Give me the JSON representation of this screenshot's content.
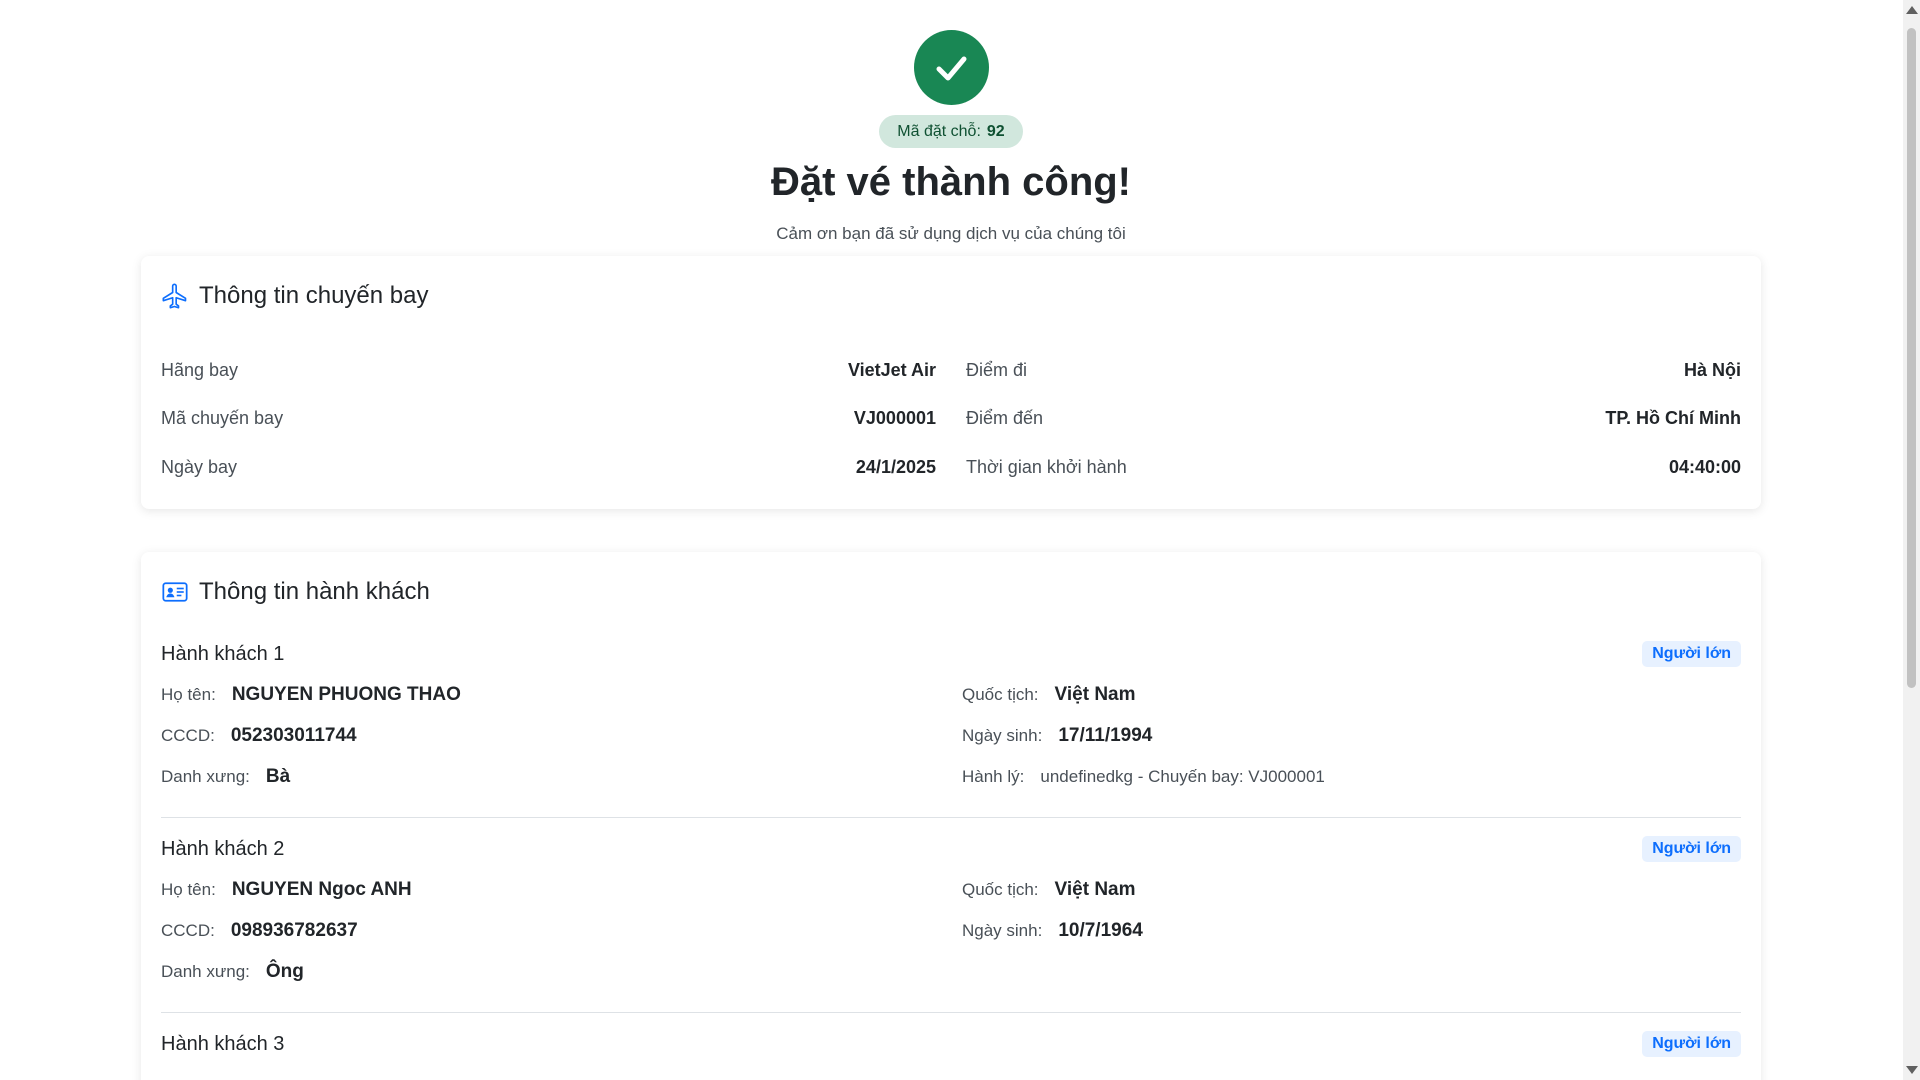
{
  "hero": {
    "booking_label": "Mã đặt chỗ:",
    "booking_code": "92",
    "title": "Đặt vé thành công!",
    "subtitle": "Cảm ơn bạn đã sử dụng dịch vụ của chúng tôi",
    "success_color": "#198754"
  },
  "flight": {
    "header": "Thông tin chuyến bay",
    "icon": "airplane-icon",
    "left": [
      {
        "label": "Hãng bay",
        "value": "VietJet Air"
      },
      {
        "label": "Mã chuyến bay",
        "value": "VJ000001"
      },
      {
        "label": "Ngày bay",
        "value": "24/1/2025"
      }
    ],
    "right": [
      {
        "label": "Điểm đi",
        "value": "Hà Nội"
      },
      {
        "label": "Điểm đến",
        "value": "TP. Hồ Chí Minh"
      },
      {
        "label": "Thời gian khởi hành",
        "value": "04:40:00"
      }
    ]
  },
  "passengers": {
    "header": "Thông tin hành khách",
    "icon": "id-card-icon",
    "labels": {
      "name": "Họ tên:",
      "id": "CCCD:",
      "title": "Danh xưng:",
      "nationality": "Quốc tịch:",
      "dob": "Ngày sinh:",
      "baggage": "Hành lý:"
    },
    "items": [
      {
        "heading": "Hành khách 1",
        "type": "Người lớn",
        "name": "NGUYEN PHUONG THAO",
        "id": "052303011744",
        "title": "Bà",
        "nationality": "Việt Nam",
        "dob": "17/11/1994",
        "baggage": "undefinedkg - Chuyến bay: VJ000001"
      },
      {
        "heading": "Hành khách 2",
        "type": "Người lớn",
        "name": "NGUYEN Ngoc ANH",
        "id": "098936782637",
        "title": "Ông",
        "nationality": "Việt Nam",
        "dob": "10/7/1964"
      },
      {
        "heading": "Hành khách 3",
        "type": "Người lớn"
      }
    ]
  }
}
